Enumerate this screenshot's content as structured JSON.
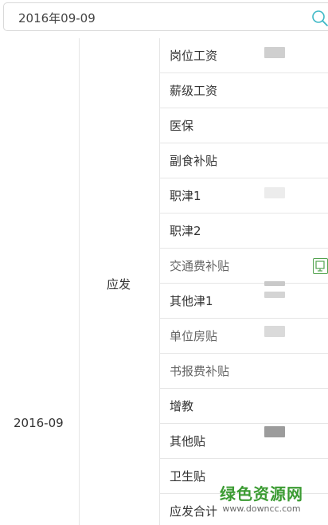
{
  "search": {
    "value": "2016年09-09",
    "icon": "search-icon"
  },
  "table": {
    "date": "2016-09",
    "group": "应发",
    "rows": [
      {
        "label": "岗位工资"
      },
      {
        "label": "薪级工资"
      },
      {
        "label": "医保"
      },
      {
        "label": "副食补贴"
      },
      {
        "label": "职津1"
      },
      {
        "label": "职津2"
      },
      {
        "label": "交通费补贴"
      },
      {
        "label": "其他津1"
      },
      {
        "label": "单位房贴"
      },
      {
        "label": "书报费补贴"
      },
      {
        "label": "增教"
      },
      {
        "label": "其他贴"
      },
      {
        "label": "卫生贴"
      },
      {
        "label": "应发合计"
      }
    ]
  },
  "watermark": {
    "title": "绿色资源网",
    "url": "www.downcc.com"
  },
  "colors": {
    "border": "#e6e6e6",
    "search_icon": "#3eb8c6",
    "watermark": "#3b9b32"
  }
}
